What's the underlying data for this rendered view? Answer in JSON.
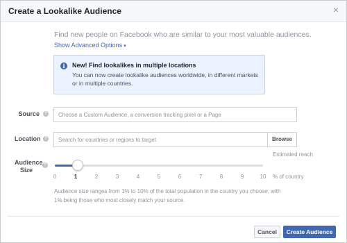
{
  "dialog": {
    "title": "Create a Lookalike Audience",
    "close_glyph": "×"
  },
  "intro": {
    "text": "Find new people on Facebook who are similar to your most valuable audiences.",
    "advanced_label": "Show Advanced Options",
    "advanced_caret": "▾"
  },
  "infobox": {
    "icon": "i",
    "title": "New! Find lookalikes in multiple locations",
    "body": "You can now create lookalike audiences worldwide, in different markets or in multiple countries."
  },
  "source": {
    "label": "Source",
    "placeholder": "Choose a Custom Audience, a conversion tracking pixel or a Page"
  },
  "location": {
    "label": "Location",
    "placeholder": "Search for countries or regions to target",
    "browse_label": "Browse"
  },
  "audience_size": {
    "label_line1": "Audience",
    "label_line2": "Size",
    "estimated_reach_label": "Estimated reach",
    "ticks": [
      "0",
      "1",
      "2",
      "3",
      "4",
      "5",
      "6",
      "7",
      "8",
      "9",
      "10"
    ],
    "selected_value": 1,
    "slider_min": 0,
    "slider_max": 10,
    "unit_label": "% of country",
    "note": "Audience size ranges from 1% to 10% of the total population in the country you choose, with 1% being those who most closely match your source."
  },
  "footer": {
    "cancel_label": "Cancel",
    "create_label": "Create Audience"
  },
  "colors": {
    "accent": "#4267b2",
    "info_bg": "#eaf3ff",
    "muted_text": "#90949c"
  },
  "icons": {
    "close": "close-icon",
    "info": "info-icon",
    "help": "help-icon",
    "caret": "chevron-down-icon"
  }
}
